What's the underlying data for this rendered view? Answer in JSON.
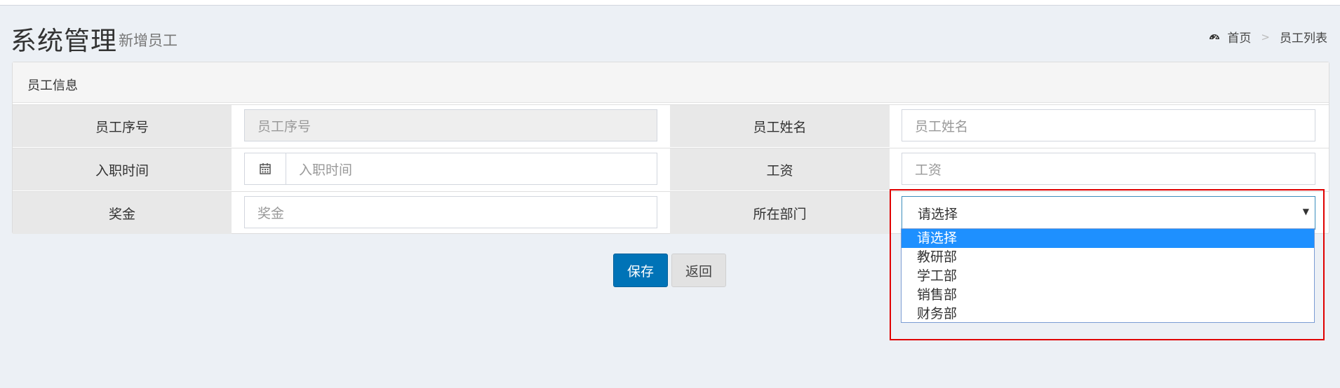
{
  "header": {
    "title": "系统管理",
    "subtitle": "新增员工"
  },
  "breadcrumb": {
    "home_icon": "dashboard-icon",
    "home": "首页",
    "separator": ">",
    "current": "员工列表"
  },
  "box": {
    "title": "员工信息"
  },
  "form": {
    "emp_id_label": "员工序号",
    "emp_id_placeholder": "员工序号",
    "emp_name_label": "员工姓名",
    "emp_name_placeholder": "员工姓名",
    "hire_date_label": "入职时间",
    "hire_date_placeholder": "入职时间",
    "hire_date_icon": "calendar-icon",
    "salary_label": "工资",
    "salary_placeholder": "工资",
    "bonus_label": "奖金",
    "bonus_placeholder": "奖金",
    "dept_label": "所在部门",
    "dept_selected": "请选择",
    "dept_options": [
      "请选择",
      "教研部",
      "学工部",
      "销售部",
      "财务部"
    ]
  },
  "buttons": {
    "save": "保存",
    "back": "返回"
  },
  "colors": {
    "primary": "#0073b7",
    "option_highlight": "#1e90ff",
    "annotation_red": "#e00000"
  }
}
